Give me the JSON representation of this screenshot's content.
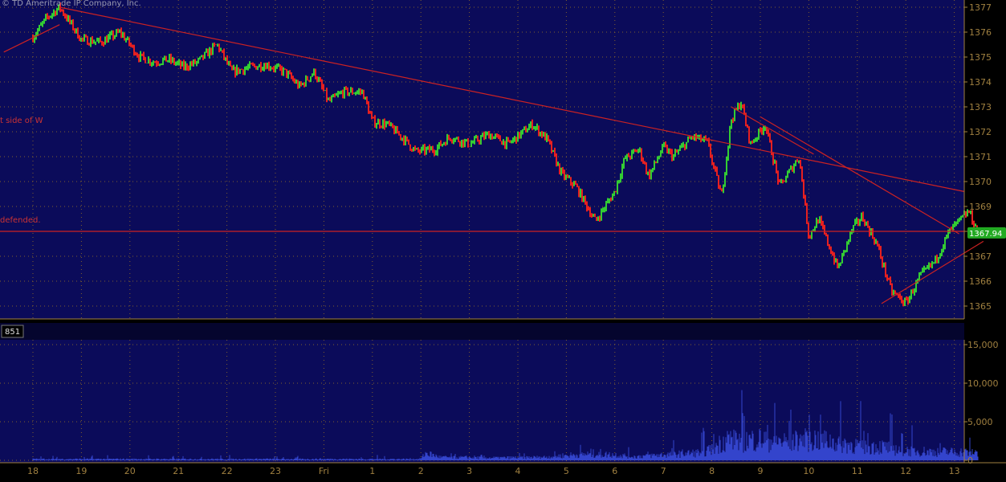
{
  "copyright": "© TD Ameritrade IP Company, Inc.",
  "annotations": {
    "w_side": "t side of W",
    "defended": "defended."
  },
  "last_price_label": "1367.94",
  "volume_panel_label": "851",
  "colors": {
    "background": "#000000",
    "plot_bg": "#0b0b5a",
    "grid": "#8c6a2a",
    "axis_text": "#a08040",
    "up_bar": "#33cc33",
    "down_bar": "#e62020",
    "trend_line": "#cc2222",
    "volume": "#3344cc",
    "price_tag": "#22aa22"
  },
  "chart_data": [
    {
      "type": "candlestick",
      "ylim": [
        1364.5,
        1377.2
      ],
      "y_ticks": [
        "1365",
        "1366",
        "1367",
        "1368",
        "1369",
        "1370",
        "1371",
        "1372",
        "1373",
        "1374",
        "1375",
        "1376",
        "1377"
      ],
      "x_ticks": [
        "18",
        "19",
        "20",
        "21",
        "22",
        "23",
        "Fri",
        "1",
        "2",
        "3",
        "4",
        "5",
        "6",
        "7",
        "8",
        "9",
        "10",
        "11",
        "12",
        "13"
      ],
      "horizontal_line": 1368.0,
      "last_price": 1367.94,
      "series": [
        {
          "x": [
            0,
            0.3,
            0.55,
            1.0,
            1.4,
            1.8,
            2.2,
            2.5,
            2.8,
            3.1,
            3.4,
            3.8,
            4.1,
            4.5,
            4.8,
            5.2,
            5.5,
            5.8,
            6.1,
            6.4,
            6.8,
            7.0,
            7.3,
            7.6,
            7.9,
            8.3,
            8.6,
            9.0,
            9.4,
            9.8,
            10.3,
            10.6,
            10.9,
            11.2,
            11.6,
            12.0,
            12.2,
            12.5,
            12.7,
            13.0,
            13.2,
            13.6,
            13.9,
            14.2,
            14.4,
            14.6,
            14.8,
            15.1,
            15.4,
            15.8,
            16.0,
            16.2,
            16.6,
            16.9,
            17.1,
            17.4,
            17.7,
            18.0,
            18.3,
            18.6,
            18.9,
            19.3,
            19.5
          ],
          "price": [
            1375.8,
            1376.6,
            1377.0,
            1375.7,
            1375.6,
            1376.0,
            1375.0,
            1374.8,
            1374.9,
            1374.6,
            1374.8,
            1375.5,
            1374.4,
            1374.6,
            1374.7,
            1374.4,
            1373.8,
            1374.4,
            1373.2,
            1373.6,
            1373.6,
            1372.4,
            1372.3,
            1371.8,
            1371.2,
            1371.3,
            1371.8,
            1371.5,
            1371.9,
            1371.5,
            1372.3,
            1371.7,
            1370.3,
            1369.8,
            1368.4,
            1369.6,
            1370.9,
            1371.3,
            1370.2,
            1371.4,
            1371.0,
            1371.8,
            1371.6,
            1369.4,
            1372.5,
            1373.2,
            1371.5,
            1372.3,
            1369.8,
            1371.0,
            1367.8,
            1368.5,
            1366.5,
            1368.1,
            1368.6,
            1367.5,
            1365.6,
            1365.1,
            1366.2,
            1366.8,
            1368.0,
            1368.8,
            1367.9
          ]
        }
      ],
      "trend_lines": [
        {
          "x": [
            -0.6,
            0.55
          ],
          "y": [
            1375.2,
            1376.3
          ]
        },
        {
          "x": [
            0.55,
            19.2
          ],
          "y": [
            1377.0,
            1369.6
          ]
        },
        {
          "x": [
            14.4,
            16.1
          ],
          "y": [
            1373.0,
            1371.1
          ]
        },
        {
          "x": [
            15.0,
            19.1
          ],
          "y": [
            1372.6,
            1367.9
          ]
        },
        {
          "x": [
            17.5,
            19.6
          ],
          "y": [
            1365.1,
            1367.6
          ]
        }
      ]
    },
    {
      "type": "bar",
      "ylim": [
        0,
        16000
      ],
      "y_ticks": [
        "0",
        "5,000",
        "10,000",
        "15,000"
      ],
      "volume_profile": {
        "x": [
          0,
          8.0,
          8.1,
          8.4,
          9.0,
          9.5,
          10.0,
          10.5,
          11.0,
          11.4,
          12.0,
          12.4,
          13.0,
          13.7,
          14.0,
          14.3,
          14.6,
          15.0,
          15.5,
          16.0,
          16.5,
          17.0,
          17.5,
          18.0,
          18.5,
          19.5
        ],
        "typical": [
          200,
          200,
          1200,
          500,
          450,
          400,
          450,
          500,
          800,
          1000,
          900,
          600,
          900,
          1200,
          1800,
          3500,
          3200,
          3400,
          3000,
          3500,
          3000,
          2400,
          2200,
          1600,
          1400,
          1300
        ],
        "peak": [
          700,
          700,
          2500,
          1200,
          900,
          800,
          1000,
          1100,
          2000,
          2500,
          2200,
          1500,
          2500,
          3500,
          5500,
          10500,
          9500,
          10000,
          9000,
          14500,
          10500,
          8000,
          7000,
          5000,
          3500,
          3500
        ]
      }
    }
  ]
}
